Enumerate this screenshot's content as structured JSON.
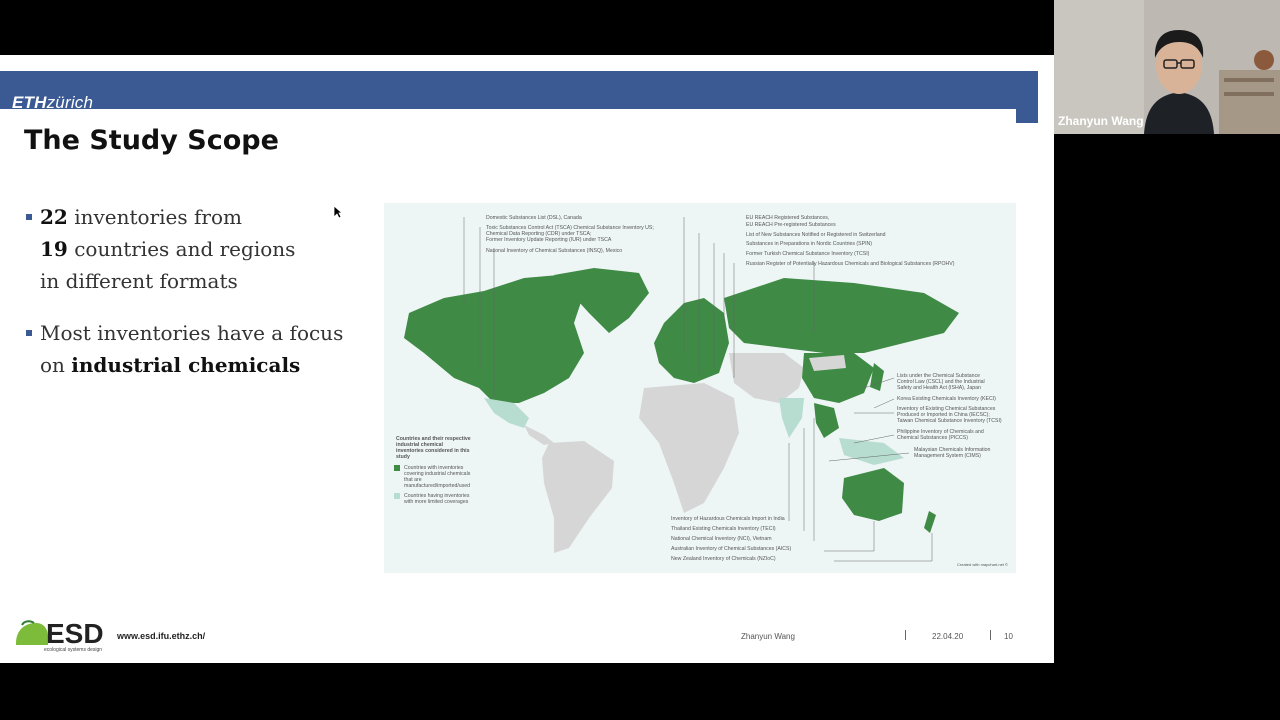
{
  "slide": {
    "logo_eth": "ETH",
    "logo_zurich": "zürich",
    "title": "The Study Scope",
    "bullets": {
      "b1": {
        "n1": "22",
        "t1": " inventories from",
        "n2": "19",
        "t2": " countries and regions",
        "t3": "in different formats"
      },
      "b2": {
        "t1": "Most inventories have a focus",
        "t2": "on ",
        "bold": "industrial chemicals"
      }
    },
    "map": {
      "labels_left": [
        "Domestic Substances List (DSL), Canada",
        "Toxic Substances Control Act (TSCA) Chemical Substance Inventory US;",
        "Chemical Data Reporting (CDR) under TSCA;",
        "Former Inventory Update Reporting (IUR) under TSCA",
        "National Inventory of Chemical Substances (INSQ), Mexico"
      ],
      "labels_top": [
        "EU REACH Registered Substances,",
        "EU REACH Pre-registered Substances",
        "List of New Substances Notified or Registered in Switzerland",
        "Substances in Preparations in Nordic Countries (SPIN)",
        "Former Turkish Chemical Substance Inventory (TCSI)",
        "Russian Register of Potentially Hazardous Chemicals and Biological Substances (RPOHV)"
      ],
      "labels_right": [
        "Lists under the Chemical Substance",
        "Control Law (CSCL) and the Industrial",
        "Safety and Health Act (ISHA), Japan",
        "Korea Existing Chemicals Inventory (KECI)",
        "Inventory of Existing Chemical Substances",
        "Produced or Imported in China (IECSC);",
        "Taiwan Chemical Substance Inventory (TCSI)",
        "Philippine Inventory of Chemicals and",
        "Chemical Substances (PICCS)",
        "Malaysian Chemicals Information",
        "Management System (CIMS)"
      ],
      "labels_bottom": [
        "Inventory of Hazardous Chemicals Import in India",
        "Thailand Existing Chemicals Inventory (TECI)",
        "National Chemical Inventory (NCI), Vietnam",
        "Australian Inventory of Chemical Substances (AICS)",
        "New Zealand Inventory of Chemicals (NZIoC)"
      ],
      "legend": {
        "title1": "Countries and their respective",
        "title2": "industrial chemical",
        "title3": "inventories considered in this",
        "title4": "study",
        "item1a": "Countries with inventories",
        "item1b": "covering industrial chemicals",
        "item1c": "that are",
        "item1d": "manufactured/imported/used",
        "item2a": "Countries having inventories",
        "item2b": "with more limited coverages"
      },
      "credit": "Created with mapchart.net ©",
      "colors": {
        "full": "#3f8a45",
        "limited": "#b7ddd0",
        "other": "#d6d6d6",
        "ocean": "#eef5f5"
      }
    },
    "footer": {
      "esd_logo": "ESD",
      "esd_sub": "ecological systems design",
      "url": "www.esd.ifu.ethz.ch/",
      "presenter": "Zhanyun Wang",
      "date": "22.04.20",
      "page": "10"
    }
  },
  "video": {
    "name": "Zhanyun Wang"
  }
}
